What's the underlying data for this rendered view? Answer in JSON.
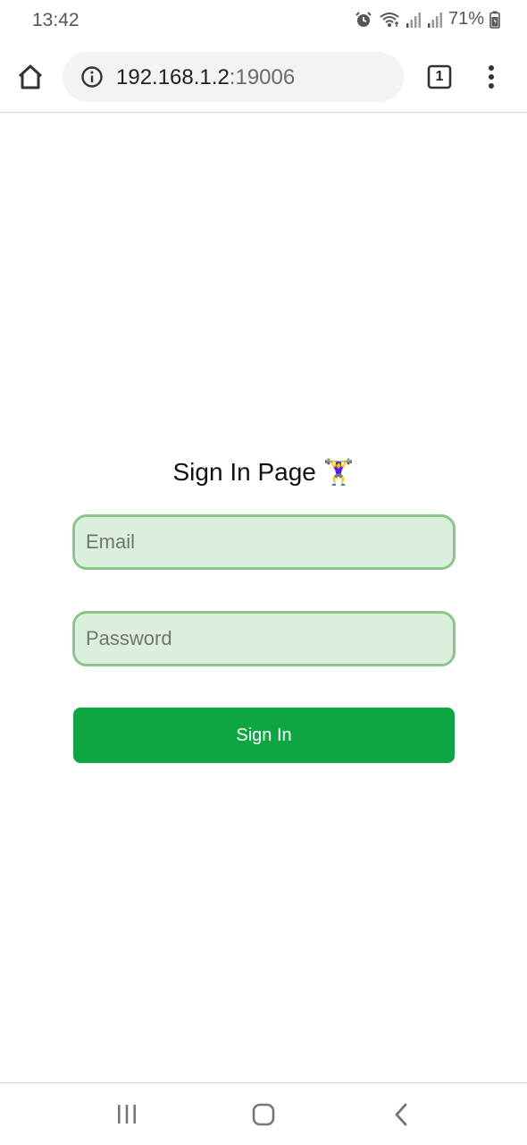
{
  "status_bar": {
    "time": "13:42",
    "battery": "71%",
    "icons": [
      "alarm-icon",
      "wifi-icon",
      "signal-icon",
      "signal-icon",
      "battery-icon"
    ]
  },
  "browser": {
    "url_host": "192.168.1.2",
    "url_port": ":19006",
    "tab_count": "1",
    "icons": [
      "home-icon",
      "info-icon",
      "tabs-icon",
      "more-vert-icon"
    ]
  },
  "page": {
    "title": "Sign In Page 🏋️‍♀️",
    "email_placeholder": "Email",
    "password_placeholder": "Password",
    "sign_in_label": "Sign In"
  },
  "colors": {
    "field_bg": "#dcefdc",
    "field_border": "#8cc58c",
    "button_green": "#0ea642"
  },
  "nav_bar": {
    "icons": [
      "recents-icon",
      "home-nav-icon",
      "back-icon"
    ]
  }
}
